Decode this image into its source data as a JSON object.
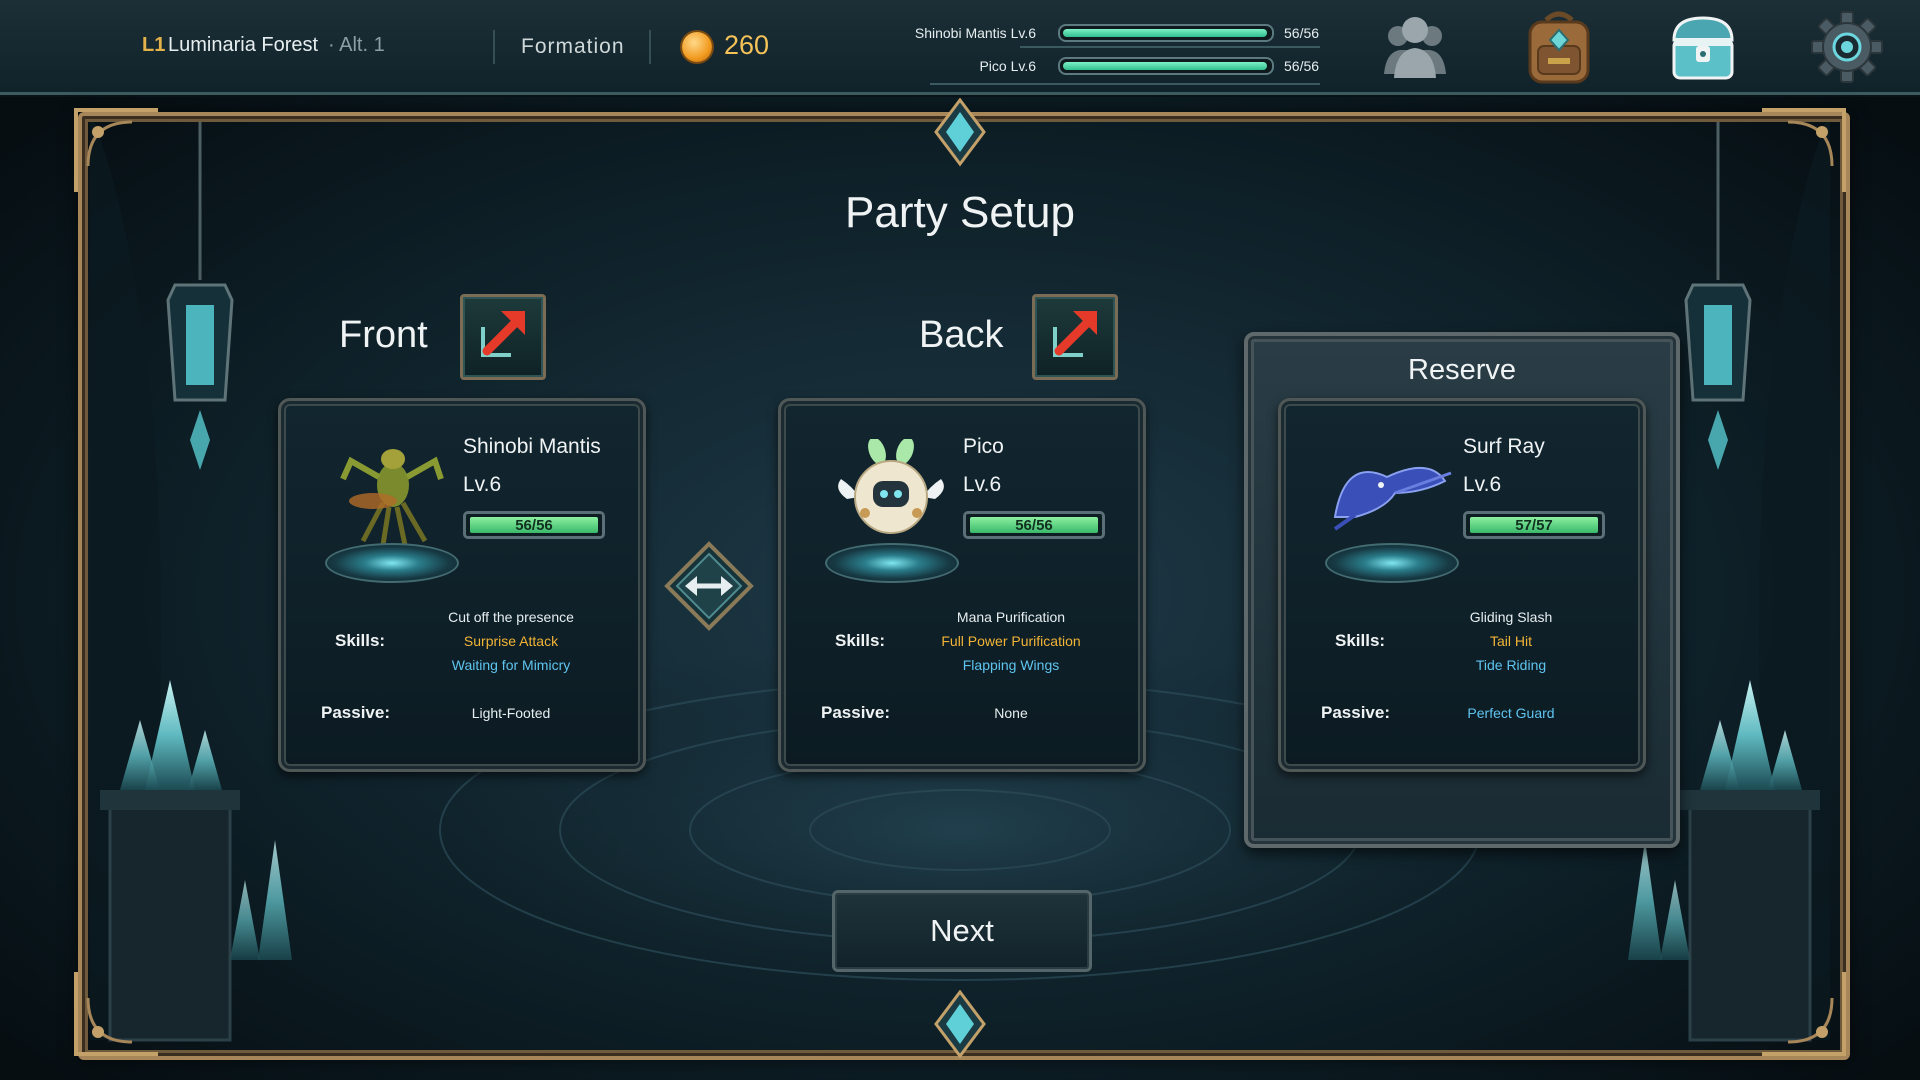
{
  "topbar": {
    "location_id": "L1",
    "location_name": "Luminaria Forest",
    "location_alt": "· Alt. 1",
    "formation_label": "Formation",
    "gold": "260",
    "party_hp": [
      {
        "label": "Shinobi Mantis Lv.6",
        "value": "56/56",
        "fraction": 1.0
      },
      {
        "label": "Pico Lv.6",
        "value": "56/56",
        "fraction": 1.0
      }
    ],
    "icons": [
      "coin-icon",
      "party-icon",
      "backpack-icon",
      "chest-icon",
      "settings-gear-icon"
    ]
  },
  "title": "Party Setup",
  "slots": {
    "front_label": "Front",
    "back_label": "Back",
    "reserve_label": "Reserve"
  },
  "cards": {
    "front": {
      "name": "Shinobi Mantis",
      "level": "Lv.6",
      "hp": "56/56",
      "hp_fraction": 1.0,
      "skills_label": "Skills:",
      "skills": [
        "Cut off the presence",
        "Surprise Attack",
        "Waiting for Mimicry"
      ],
      "passive_label": "Passive:",
      "passive": "Light-Footed"
    },
    "back": {
      "name": "Pico",
      "level": "Lv.6",
      "hp": "56/56",
      "hp_fraction": 1.0,
      "skills_label": "Skills:",
      "skills": [
        "Mana Purification",
        "Full Power Purification",
        "Flapping Wings"
      ],
      "passive_label": "Passive:",
      "passive": "None"
    },
    "reserve": {
      "name": "Surf Ray",
      "level": "Lv.6",
      "hp": "57/57",
      "hp_fraction": 1.0,
      "skills_label": "Skills:",
      "skills": [
        "Gliding Slash",
        "Tail Hit",
        "Tide Riding"
      ],
      "passive_label": "Passive:",
      "passive": "Perfect Guard"
    }
  },
  "next_label": "Next",
  "colors": {
    "accent_gold": "#f4c258",
    "skill_gold": "#f2b436",
    "skill_blue": "#5fc4f0",
    "hp_green": "#3ab86a",
    "frame_bronze": "#a7865a"
  }
}
